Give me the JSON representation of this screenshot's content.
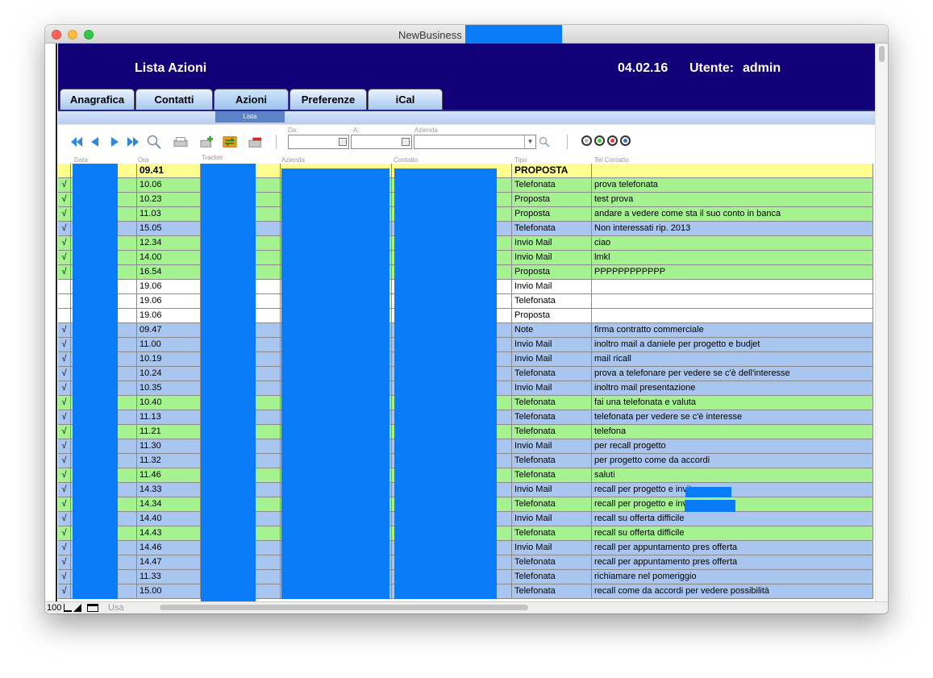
{
  "window": {
    "title": "NewBusiness"
  },
  "header": {
    "title": "Lista Azioni",
    "date": "04.02.16",
    "user_label": "Utente:",
    "user_value": "admin"
  },
  "tabs": [
    {
      "label": "Anagrafica",
      "active": false
    },
    {
      "label": "Contatti",
      "active": false
    },
    {
      "label": "Azioni",
      "active": true
    },
    {
      "label": "Preferenze",
      "active": false
    },
    {
      "label": "iCal",
      "active": false
    }
  ],
  "subtab": {
    "label": "Lista"
  },
  "toolbar": {
    "icons": [
      "first-record-icon",
      "previous-record-icon",
      "next-record-icon",
      "last-record-icon",
      "search-icon",
      "print-icon",
      "new-record-icon",
      "swap-icon",
      "delete-record-icon"
    ],
    "from_label": "Da:",
    "to_label": "A:",
    "company_label": "Azienda",
    "from_value": "",
    "to_value": "",
    "company_value": "",
    "radio_colors": [
      "#bbbbbb",
      "#2fd12f",
      "#ff2d2d",
      "#2b6fe0"
    ]
  },
  "columns": [
    "Data",
    "Ora",
    "Tracker",
    "Azienda",
    "Contatto",
    "Tipo",
    "Tel Contatto"
  ],
  "rows": [
    {
      "color": "yellow",
      "check": "",
      "ora": "09.41",
      "tipo": "PROPOSTA",
      "note": ""
    },
    {
      "color": "green",
      "check": "√",
      "ora": "10.06",
      "tipo": "Telefonata",
      "note": "prova telefonata"
    },
    {
      "color": "green",
      "check": "√",
      "ora": "10.23",
      "tipo": "Proposta",
      "note": "test prova"
    },
    {
      "color": "green",
      "check": "√",
      "ora": "11.03",
      "tipo": "Proposta",
      "note": "andare a vedere come sta il suo conto in banca"
    },
    {
      "color": "blue",
      "check": "√",
      "ora": "15.05",
      "tipo": "Telefonata",
      "note": "Non interessati rip. 2013"
    },
    {
      "color": "green",
      "check": "√",
      "ora": "12.34",
      "tipo": "Invio Mail",
      "note": "ciao"
    },
    {
      "color": "green",
      "check": "√",
      "ora": "14.00",
      "tipo": "Invio Mail",
      "note": "lmkl"
    },
    {
      "color": "green",
      "check": "√",
      "ora": "16.54",
      "tipo": "Proposta",
      "note": "PPPPPPPPPPPP"
    },
    {
      "color": "white",
      "check": "",
      "ora": "19.06",
      "tipo": "Invio Mail",
      "note": ""
    },
    {
      "color": "white",
      "check": "",
      "ora": "19.06",
      "tipo": "Telefonata",
      "note": ""
    },
    {
      "color": "white",
      "check": "",
      "ora": "19.06",
      "tipo": "Proposta",
      "note": ""
    },
    {
      "color": "blue",
      "check": "√",
      "ora": "09.47",
      "tipo": "Note",
      "note": "firma contratto commerciale"
    },
    {
      "color": "blue",
      "check": "√",
      "ora": "11.00",
      "tipo": "Invio Mail",
      "note": "inoltro mail a daniele per progetto e budjet"
    },
    {
      "color": "blue",
      "check": "√",
      "ora": "10.19",
      "tipo": "Invio Mail",
      "note": "mail ricall"
    },
    {
      "color": "blue",
      "check": "√",
      "ora": "10.24",
      "tipo": "Telefonata",
      "note": "prova a telefonare per vedere se c'è dell'interesse"
    },
    {
      "color": "blue",
      "check": "√",
      "ora": "10.35",
      "tipo": "Invio Mail",
      "note": "inoltro mail presentazione"
    },
    {
      "color": "green",
      "check": "√",
      "ora": "10.40",
      "tipo": "Telefonata",
      "note": "fai una telefonata e valuta"
    },
    {
      "color": "blue",
      "check": "√",
      "ora": "11.13",
      "tipo": "Telefonata",
      "note": "telefonata per vedere se c'è interesse"
    },
    {
      "color": "green",
      "check": "√",
      "ora": "11.21",
      "tipo": "Telefonata",
      "note": "telefona"
    },
    {
      "color": "blue",
      "check": "√",
      "ora": "11.30",
      "tipo": "Invio Mail",
      "note": "per recall progetto"
    },
    {
      "color": "blue",
      "check": "√",
      "ora": "11.32",
      "tipo": "Telefonata",
      "note": "per progetto come da accordi"
    },
    {
      "color": "green",
      "check": "√",
      "ora": "11.46",
      "tipo": "Telefonata",
      "note": "saluti"
    },
    {
      "color": "blue",
      "check": "√",
      "ora": "14.33",
      "tipo": "Invio Mail",
      "note": "recall per progetto e invito"
    },
    {
      "color": "green",
      "check": "√",
      "ora": "14.34",
      "tipo": "Telefonata",
      "note": "recall per progetto e invito"
    },
    {
      "color": "blue",
      "check": "√",
      "ora": "14.40",
      "tipo": "Invio Mail",
      "note": "recall su offerta difficile"
    },
    {
      "color": "green",
      "check": "√",
      "ora": "14.43",
      "tipo": "Telefonata",
      "note": "recall su offerta difficile"
    },
    {
      "color": "blue",
      "check": "√",
      "ora": "14.46",
      "tipo": "Invio Mail",
      "note": "recall per appuntamento pres offerta"
    },
    {
      "color": "blue",
      "check": "√",
      "ora": "14.47",
      "tipo": "Telefonata",
      "note": "recall per appuntamento pres offerta"
    },
    {
      "color": "blue",
      "check": "√",
      "ora": "11.33",
      "tipo": "Telefonata",
      "note": "richiamare nel pomeriggio"
    },
    {
      "color": "blue",
      "check": "√",
      "ora": "15.00",
      "tipo": "Telefonata",
      "note": "recall come da accordi per vedere possibilità"
    }
  ],
  "statusbar": {
    "zoom": "100",
    "mode": "Usa"
  }
}
